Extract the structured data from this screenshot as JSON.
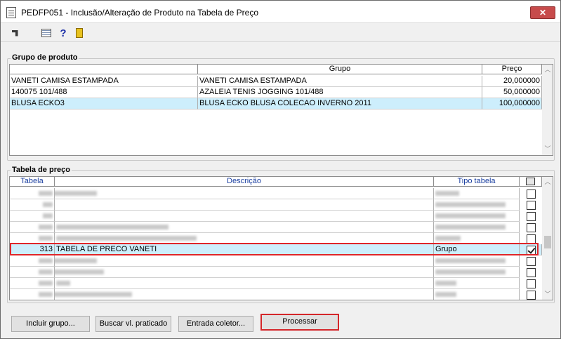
{
  "window": {
    "title": "PEDFP051 - Inclusão/Alteração de Produto na Tabela de Preço",
    "close_label": "✕"
  },
  "toolbar": {
    "icons": [
      "cursor-arrow-icon",
      "calendar-grid-icon",
      "help-icon",
      "exit-door-icon"
    ],
    "help_glyph": "?"
  },
  "product_group": {
    "section_label": "Grupo de produto",
    "columns": [
      "Grupo",
      "Preço"
    ],
    "rows": [
      {
        "code": "VANETI CAMISA ESTAMPADA",
        "grupo": "VANETI CAMISA ESTAMPADA",
        "preco": "20,000000",
        "selected": false
      },
      {
        "code": "140075 101/488",
        "grupo": "AZALEIA TENIS JOGGING 101/488",
        "preco": "50,000000",
        "selected": false
      },
      {
        "code": "BLUSA ECKO3",
        "grupo": "BLUSA ECKO BLUSA COLECAO INVERNO 2011",
        "preco": "100,000000",
        "selected": true
      }
    ]
  },
  "price_table": {
    "section_label": "Tabela de preço",
    "columns": [
      "Tabela",
      "Descrição",
      "Tipo tabela"
    ],
    "highlighted_row": {
      "tabela": "313",
      "descricao": "TABELA DE PRECO VANETI",
      "tipo": "Grupo",
      "checked": true
    }
  },
  "buttons": {
    "incluir_grupo": "Incluir grupo...",
    "buscar_vl": "Buscar vl. praticado",
    "entrada_coletor": "Entrada coletor...",
    "processar": "Processar"
  },
  "colors": {
    "selected_row": "#cdeefc",
    "highlight_border": "#e0262a",
    "close_button": "#c74b4b"
  }
}
